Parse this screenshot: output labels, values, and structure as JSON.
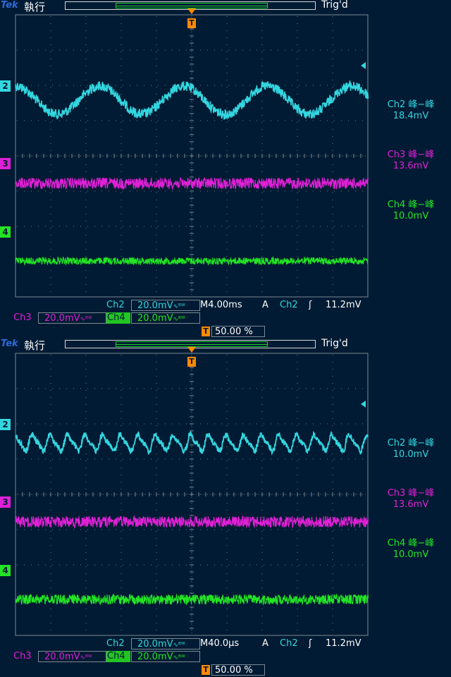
{
  "panels": [
    {
      "brand": "Tek",
      "run_state": "執行",
      "trig_state": "Trig'd",
      "trigger_marker": "T",
      "channel_markers": [
        "2",
        "3",
        "4"
      ],
      "measurements": [
        {
          "label": "Ch2 峰−峰",
          "value": "18.4mV"
        },
        {
          "label": "Ch3 峰−峰",
          "value": "13.6mV"
        },
        {
          "label": "Ch4 峰−峰",
          "value": "10.0mV"
        }
      ],
      "status": {
        "ch2_name": "Ch2",
        "ch2_scale": "20.0mV",
        "timebase": "M4.00ms",
        "trig_mode": "A",
        "trig_src": "Ch2",
        "trig_slope": "ʃ",
        "trig_level": "11.2mV",
        "ch3_name": "Ch3",
        "ch3_scale": "20.0mV",
        "ch4_name": "Ch4",
        "ch4_scale": "20.0mV",
        "bw_icon_text": "∿ᴮᵂ",
        "trig_pos": "50.00 %"
      },
      "traces": {
        "ch2_cycles": 4.2,
        "ch2_amp_div": 0.4
      }
    },
    {
      "brand": "Tek",
      "run_state": "執行",
      "trig_state": "Trig'd",
      "trigger_marker": "T",
      "channel_markers": [
        "2",
        "3",
        "4"
      ],
      "measurements": [
        {
          "label": "Ch2 峰−峰",
          "value": "10.0mV"
        },
        {
          "label": "Ch3 峰−峰",
          "value": "13.6mV"
        },
        {
          "label": "Ch4 峰−峰",
          "value": "10.0mV"
        }
      ],
      "status": {
        "ch2_name": "Ch2",
        "ch2_scale": "20.0mV",
        "timebase": "M40.0µs",
        "trig_mode": "A",
        "trig_src": "Ch2",
        "trig_slope": "ʃ",
        "trig_level": "11.2mV",
        "ch3_name": "Ch3",
        "ch3_scale": "20.0mV",
        "ch4_name": "Ch4",
        "ch4_scale": "20.0mV",
        "bw_icon_text": "∿ᴮᵂ",
        "trig_pos": "50.00 %"
      },
      "traces": {
        "ch2_cycles": 20,
        "ch2_amp_div": 0.2
      }
    }
  ],
  "colors": {
    "ch2": "#33d6e0",
    "ch3": "#e020d6",
    "ch4": "#23e523",
    "trigger": "#ff8a00",
    "grid": "#7d8a96"
  }
}
